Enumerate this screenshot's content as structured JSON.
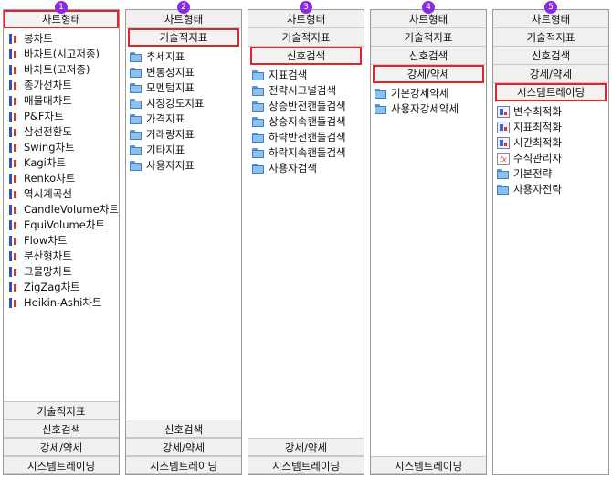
{
  "panels": [
    {
      "step": "1",
      "top_tabs": [
        "차트형태"
      ],
      "selected_tab": 0,
      "items": [
        {
          "label": "봉차트",
          "icon": "candle-chart-icon"
        },
        {
          "label": "바차트(시고저종)",
          "icon": "candle-chart-icon"
        },
        {
          "label": "바차트(고저종)",
          "icon": "candle-chart-icon"
        },
        {
          "label": "종가선차트",
          "icon": "candle-chart-icon"
        },
        {
          "label": "매물대차트",
          "icon": "candle-chart-icon"
        },
        {
          "label": "P&F차트",
          "icon": "candle-chart-icon"
        },
        {
          "label": "삼선전환도",
          "icon": "candle-chart-icon"
        },
        {
          "label": "Swing차트",
          "icon": "candle-chart-icon"
        },
        {
          "label": "Kagi차트",
          "icon": "candle-chart-icon"
        },
        {
          "label": "Renko차트",
          "icon": "candle-chart-icon"
        },
        {
          "label": "역시계곡선",
          "icon": "candle-chart-icon"
        },
        {
          "label": "CandleVolume차트",
          "icon": "candle-chart-icon"
        },
        {
          "label": "EquiVolume차트",
          "icon": "candle-chart-icon"
        },
        {
          "label": "Flow차트",
          "icon": "candle-chart-icon"
        },
        {
          "label": "분산형차트",
          "icon": "candle-chart-icon"
        },
        {
          "label": "그물망차트",
          "icon": "candle-chart-icon"
        },
        {
          "label": "ZigZag차트",
          "icon": "candle-chart-icon"
        },
        {
          "label": "Heikin-Ashi차트",
          "icon": "candle-chart-icon"
        }
      ],
      "bottom_tabs": [
        "기술적지표",
        "신호검색",
        "강세/약세",
        "시스템트레이딩"
      ]
    },
    {
      "step": "2",
      "top_tabs": [
        "차트형태",
        "기술적지표"
      ],
      "selected_tab": 1,
      "items": [
        {
          "label": "추세지표",
          "icon": "folder-icon"
        },
        {
          "label": "변동성지표",
          "icon": "folder-icon"
        },
        {
          "label": "모멘텀지표",
          "icon": "folder-icon"
        },
        {
          "label": "시장강도지표",
          "icon": "folder-icon"
        },
        {
          "label": "가격지표",
          "icon": "folder-icon"
        },
        {
          "label": "거래량지표",
          "icon": "folder-icon"
        },
        {
          "label": "기타지표",
          "icon": "folder-icon"
        },
        {
          "label": "사용자지표",
          "icon": "folder-icon"
        }
      ],
      "bottom_tabs": [
        "신호검색",
        "강세/약세",
        "시스템트레이딩"
      ]
    },
    {
      "step": "3",
      "top_tabs": [
        "차트형태",
        "기술적지표",
        "신호검색"
      ],
      "selected_tab": 2,
      "items": [
        {
          "label": "지표검색",
          "icon": "folder-icon"
        },
        {
          "label": "전략시그널검색",
          "icon": "folder-icon"
        },
        {
          "label": "상승반전캔들검색",
          "icon": "folder-icon"
        },
        {
          "label": "상승지속캔들검색",
          "icon": "folder-icon"
        },
        {
          "label": "하락반전캔들검색",
          "icon": "folder-icon"
        },
        {
          "label": "하락지속캔들검색",
          "icon": "folder-icon"
        },
        {
          "label": "사용자검색",
          "icon": "folder-icon"
        }
      ],
      "bottom_tabs": [
        "강세/약세",
        "시스템트레이딩"
      ]
    },
    {
      "step": "4",
      "top_tabs": [
        "차트형태",
        "기술적지표",
        "신호검색",
        "강세/약세"
      ],
      "selected_tab": 3,
      "items": [
        {
          "label": "기본강세약세",
          "icon": "folder-icon"
        },
        {
          "label": "사용자강세약세",
          "icon": "folder-icon"
        }
      ],
      "bottom_tabs": [
        "시스템트레이딩"
      ]
    },
    {
      "step": "5",
      "top_tabs": [
        "차트형태",
        "기술적지표",
        "신호검색",
        "강세/약세",
        "시스템트레이딩"
      ],
      "selected_tab": 4,
      "items": [
        {
          "label": "변수최적화",
          "icon": "optimize-icon"
        },
        {
          "label": "지표최적화",
          "icon": "optimize-icon"
        },
        {
          "label": "시간최적화",
          "icon": "optimize-icon"
        },
        {
          "label": "수식관리자",
          "icon": "formula-icon"
        },
        {
          "label": "기본전략",
          "icon": "folder-icon"
        },
        {
          "label": "사용자전략",
          "icon": "folder-icon"
        }
      ],
      "bottom_tabs": []
    }
  ],
  "colors": {
    "badge": "#8a2be2",
    "selected_border": "#e2232e",
    "tab_bg": "#f0f0f0",
    "folder": "#8cc0ef"
  }
}
